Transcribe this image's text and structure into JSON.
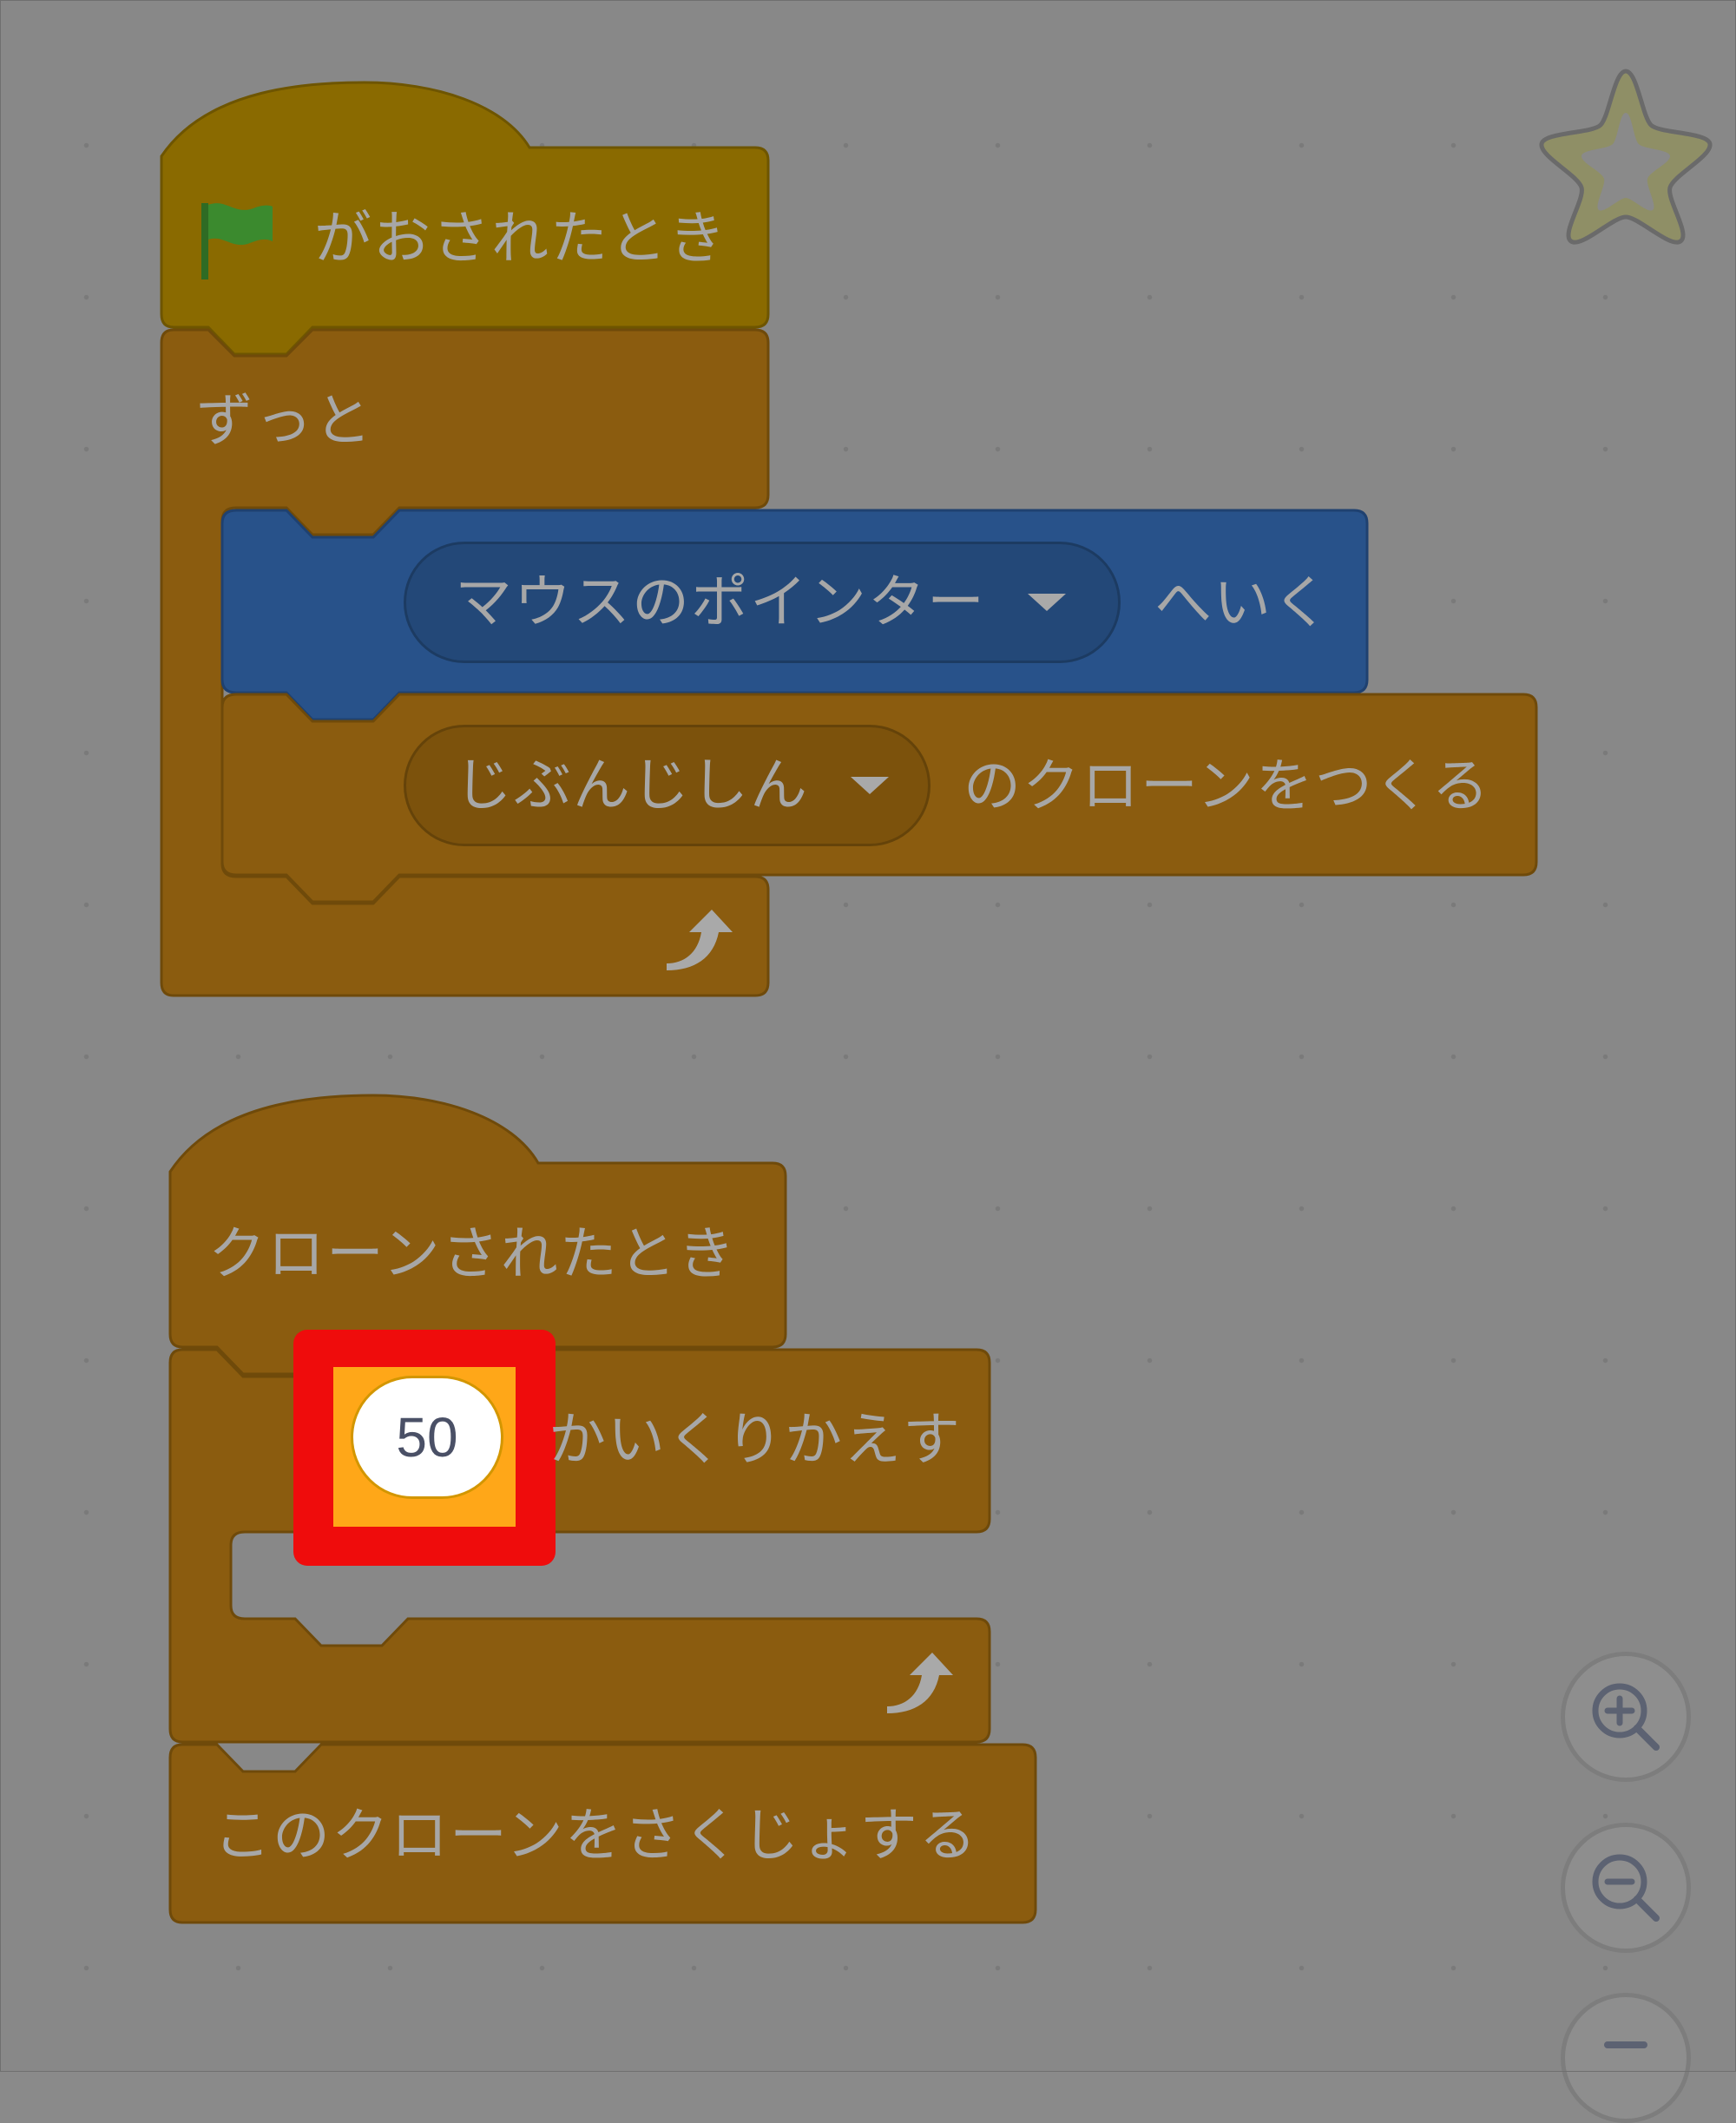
{
  "script1": {
    "hat_label": "がおされたとき",
    "forever_label": "ずっと",
    "goto_menu": "マウスのポインター",
    "goto_label": "へいく",
    "clone_menu": "じぶんじしん",
    "clone_label": "のクローンをつくる"
  },
  "script2": {
    "hat_label": "クローンされたとき",
    "repeat_count": "50",
    "repeat_label": "かいくりかえす",
    "delete_label": "このクローンをさくじょする"
  },
  "colors": {
    "events_dim": "#8a6a00",
    "control_dim": "#8b5c0f",
    "motion_dim": "#28528a",
    "highlight": "#ef0c0c",
    "highlight_fill": "#ffa718"
  },
  "icons": {
    "flag": "green-flag-icon",
    "loop_arrow": "loop-arrow-icon",
    "star": "favorite-star-icon",
    "zoom_in": "zoom-in-icon",
    "zoom_out": "zoom-out-icon",
    "reset": "zoom-reset-icon"
  }
}
